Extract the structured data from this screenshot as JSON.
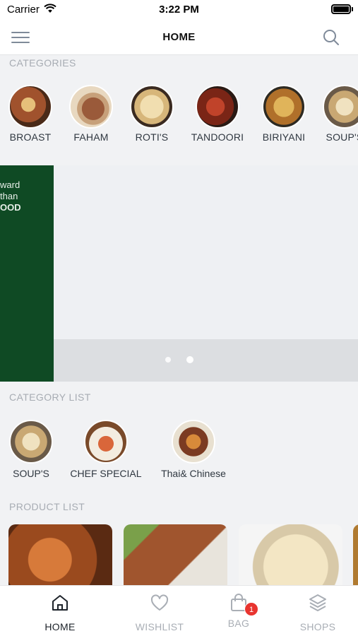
{
  "status_bar": {
    "carrier": "Carrier",
    "time": "3:22 PM"
  },
  "header": {
    "title": "HOME",
    "menu_icon": "menu-icon",
    "search_icon": "search-icon"
  },
  "categories": {
    "heading": "CATEGORIES",
    "items": [
      {
        "label": "BROAST",
        "color": "#8a4a22"
      },
      {
        "label": "FAHAM",
        "color": "#7a4630"
      },
      {
        "label": "ROTI'S",
        "color": "#c9a56a"
      },
      {
        "label": "TANDOORI",
        "color": "#8c2c1c"
      },
      {
        "label": "BIRIYANI",
        "color": "#b8862e"
      },
      {
        "label": "SOUP'S",
        "color": "#c7b28a"
      }
    ]
  },
  "banner": {
    "lines": [
      "ward",
      "than",
      "OOD"
    ],
    "bg_color": "#0f4a24",
    "slides": 2,
    "active_slide": 2
  },
  "category_list": {
    "heading": "CATEGORY LIST",
    "items": [
      {
        "label": "SOUP'S",
        "color": "#c7b28a"
      },
      {
        "label": "CHEF SPECIAL",
        "color": "#a5552c"
      },
      {
        "label": "Thai& Chinese",
        "color": "#7b3b22"
      }
    ]
  },
  "product_list": {
    "heading": "PRODUCT LIST"
  },
  "tabbar": {
    "items": [
      {
        "label": "HOME",
        "icon": "home-icon",
        "active": true
      },
      {
        "label": "WISHLIST",
        "icon": "heart-icon",
        "active": false
      },
      {
        "label": "BAG",
        "icon": "bag-icon",
        "active": false,
        "badge": "1"
      },
      {
        "label": "SHOPS",
        "icon": "layers-icon",
        "active": false
      }
    ]
  },
  "colors": {
    "accent": "#0f4a24",
    "badge": "#e8342f",
    "muted": "#a7acb3"
  }
}
